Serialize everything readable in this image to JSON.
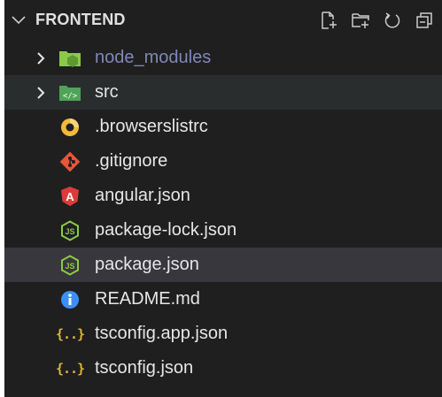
{
  "explorer": {
    "title": "FRONTEND",
    "actions": [
      {
        "name": "new-file-icon",
        "label": "New File"
      },
      {
        "name": "new-folder-icon",
        "label": "New Folder"
      },
      {
        "name": "refresh-icon",
        "label": "Refresh"
      },
      {
        "name": "collapse-all-icon",
        "label": "Collapse All"
      }
    ]
  },
  "tree": [
    {
      "label": "node_modules",
      "type": "folder",
      "icon": "folder-node-icon",
      "expanded": false
    },
    {
      "label": "src",
      "type": "folder",
      "icon": "folder-src-icon",
      "expanded": false
    },
    {
      "label": ".browserslistrc",
      "type": "file",
      "icon": "browserslist-icon"
    },
    {
      "label": ".gitignore",
      "type": "file",
      "icon": "git-icon"
    },
    {
      "label": "angular.json",
      "type": "file",
      "icon": "angular-icon"
    },
    {
      "label": "package-lock.json",
      "type": "file",
      "icon": "nodejs-icon"
    },
    {
      "label": "package.json",
      "type": "file",
      "icon": "nodejs-icon"
    },
    {
      "label": "README.md",
      "type": "file",
      "icon": "info-icon"
    },
    {
      "label": "tsconfig.app.json",
      "type": "file",
      "icon": "json-braces-icon"
    },
    {
      "label": "tsconfig.json",
      "type": "file",
      "icon": "json-braces-icon"
    }
  ],
  "colors": {
    "background": "#1f1f1f",
    "selected_row": "#37373d",
    "dim_label": "#7f88b9",
    "angular": "#dd3a3a",
    "node_green": "#8cc84b",
    "git": "#e8553a",
    "browserslist": "#f2b93b",
    "info": "#3e8ef7",
    "json_braces": "#d9b441"
  }
}
